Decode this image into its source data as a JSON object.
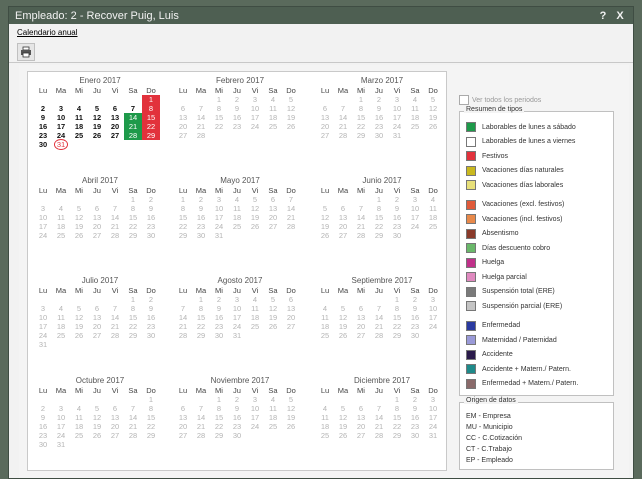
{
  "window": {
    "title": "Empleado: 2 - Recover Puig, Luis",
    "btn_help": "?",
    "btn_close": "X"
  },
  "menu": {
    "item": "Calendario anual"
  },
  "toolbar": {
    "print_icon": "printer-icon"
  },
  "weekdays": [
    "Lu",
    "Ma",
    "Mi",
    "Ju",
    "Vi",
    "Sa",
    "Do"
  ],
  "months": [
    {
      "title": "Enero 2017",
      "offset": 6,
      "days": 31
    },
    {
      "title": "Febrero 2017",
      "offset": 2,
      "days": 28
    },
    {
      "title": "Marzo 2017",
      "offset": 2,
      "days": 31
    },
    {
      "title": "Abril 2017",
      "offset": 5,
      "days": 30
    },
    {
      "title": "Mayo 2017",
      "offset": 0,
      "days": 31
    },
    {
      "title": "Junio 2017",
      "offset": 3,
      "days": 30
    },
    {
      "title": "Julio 2017",
      "offset": 5,
      "days": 31
    },
    {
      "title": "Agosto 2017",
      "offset": 1,
      "days": 31
    },
    {
      "title": "Septiembre 2017",
      "offset": 4,
      "days": 30
    },
    {
      "title": "Octubre 2017",
      "offset": 6,
      "days": 31
    },
    {
      "title": "Noviembre 2017",
      "offset": 2,
      "days": 30
    },
    {
      "title": "Diciembre 2017",
      "offset": 4,
      "days": 31
    }
  ],
  "active_through": {
    "month": 0,
    "day": 30
  },
  "marked": {
    "red": [
      1,
      8,
      15,
      22,
      29
    ],
    "green": [
      14,
      21,
      28
    ],
    "circled": 31
  },
  "show_all": {
    "label": "Ver todos los periodos"
  },
  "legend": {
    "title": "Resumen de tipos",
    "items": [
      {
        "label": "Laborables de lunes a sábado",
        "color": "#1e9a4a"
      },
      {
        "label": "Laborables de lunes a viernes",
        "color": "#ffffff"
      },
      {
        "label": "Festivos",
        "color": "#e2323c"
      },
      {
        "label": "Vacaciones días naturales",
        "color": "#c9b81e"
      },
      {
        "label": "Vacaciones días laborales",
        "color": "#e8e07a"
      },
      {
        "label": "Vacaciones (excl. festivos)",
        "color": "#e05a3a"
      },
      {
        "label": "Vacaciones (incl. festivos)",
        "color": "#e8894a"
      },
      {
        "label": "Absentismo",
        "color": "#8a3a2a"
      },
      {
        "label": "Días descuento cobro",
        "color": "#6ab86a"
      },
      {
        "label": "Huelga",
        "color": "#c0308a"
      },
      {
        "label": "Huelga parcial",
        "color": "#e08ac0"
      },
      {
        "label": "Suspensión total (ERE)",
        "color": "#7a7a7a"
      },
      {
        "label": "Suspensión parcial (ERE)",
        "color": "#c4c4c4"
      },
      {
        "label": "Enfermedad",
        "color": "#2a3aa0"
      },
      {
        "label": "Maternidad / Paternidad",
        "color": "#9a9ad8"
      },
      {
        "label": "Accidente",
        "color": "#2a1a4a"
      },
      {
        "label": "Accidente + Matern./ Patern.",
        "color": "#1e8a8a"
      },
      {
        "label": "Enfermedad + Matern./ Patern.",
        "color": "#8a6a6a"
      }
    ]
  },
  "origin": {
    "title": "Origen de datos",
    "items": [
      "EM - Empresa",
      "MU - Municipio",
      "CC - C.Cotización",
      "CT - C.Trabajo",
      "EP - Empleado"
    ]
  }
}
